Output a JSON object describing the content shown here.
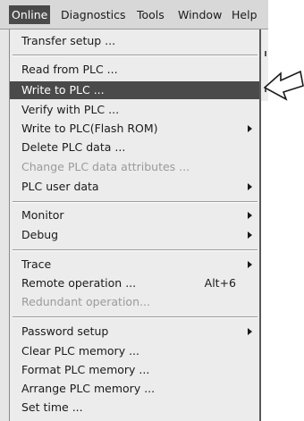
{
  "menubar": {
    "items": [
      {
        "label": "Online",
        "active": true
      },
      {
        "label": "Diagnostics",
        "active": false
      },
      {
        "label": "Tools",
        "active": false
      },
      {
        "label": "Window",
        "active": false
      },
      {
        "label": "Help",
        "active": false
      }
    ]
  },
  "menu": {
    "items": [
      {
        "label": "Transfer setup ...",
        "enabled": true
      },
      {
        "label": "Read from PLC ...",
        "enabled": true
      },
      {
        "label": "Write to PLC ...",
        "enabled": true,
        "highlighted": true
      },
      {
        "label": "Verify with PLC ...",
        "enabled": true
      },
      {
        "label": "Write to PLC(Flash ROM)",
        "enabled": true,
        "submenu": true
      },
      {
        "label": "Delete PLC data ...",
        "enabled": true
      },
      {
        "label": "Change PLC data attributes ...",
        "enabled": false
      },
      {
        "label": "PLC user data",
        "enabled": true,
        "submenu": true
      },
      {
        "label": "Monitor",
        "enabled": true,
        "submenu": true
      },
      {
        "label": "Debug",
        "enabled": true,
        "submenu": true
      },
      {
        "label": "Trace",
        "enabled": true,
        "submenu": true
      },
      {
        "label": "Remote operation ...",
        "enabled": true,
        "shortcut": "Alt+6"
      },
      {
        "label": "Redundant operation...",
        "enabled": false
      },
      {
        "label": "Password setup",
        "enabled": true,
        "submenu": true
      },
      {
        "label": "Clear PLC memory ...",
        "enabled": true
      },
      {
        "label": "Format PLC memory ...",
        "enabled": true
      },
      {
        "label": "Arrange PLC memory ...",
        "enabled": true
      },
      {
        "label": "Set time ...",
        "enabled": true
      }
    ]
  },
  "colors": {
    "highlight": "#4a4a4a",
    "menu_bg": "#ececec",
    "disabled_text": "#9a9a9a"
  },
  "icons": {
    "pointer": "outline-arrow-pointing-left"
  }
}
